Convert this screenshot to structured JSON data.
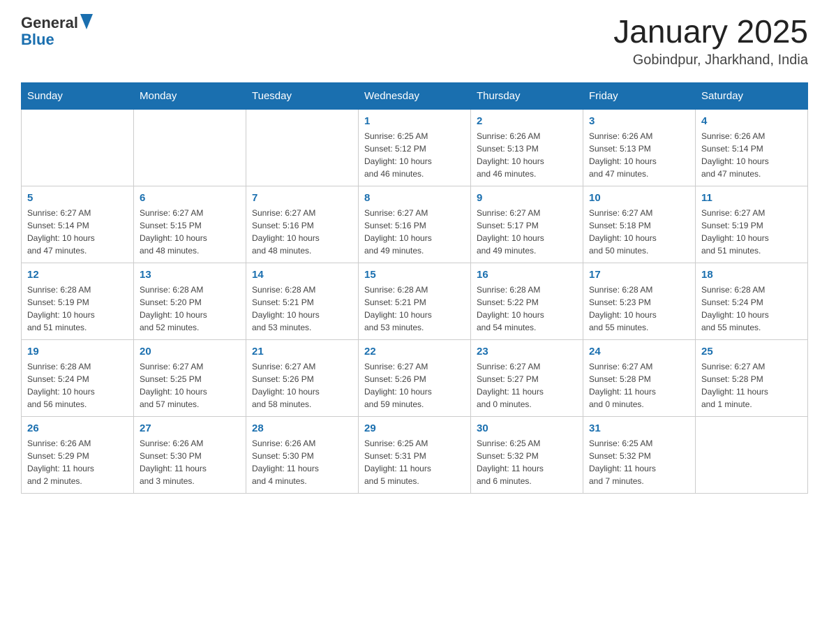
{
  "header": {
    "logo": {
      "text_general": "General",
      "text_blue": "Blue",
      "alt": "GeneralBlue logo"
    },
    "title": "January 2025",
    "subtitle": "Gobindpur, Jharkhand, India"
  },
  "weekdays": [
    "Sunday",
    "Monday",
    "Tuesday",
    "Wednesday",
    "Thursday",
    "Friday",
    "Saturday"
  ],
  "weeks": [
    [
      {
        "day": "",
        "info": ""
      },
      {
        "day": "",
        "info": ""
      },
      {
        "day": "",
        "info": ""
      },
      {
        "day": "1",
        "info": "Sunrise: 6:25 AM\nSunset: 5:12 PM\nDaylight: 10 hours\nand 46 minutes."
      },
      {
        "day": "2",
        "info": "Sunrise: 6:26 AM\nSunset: 5:13 PM\nDaylight: 10 hours\nand 46 minutes."
      },
      {
        "day": "3",
        "info": "Sunrise: 6:26 AM\nSunset: 5:13 PM\nDaylight: 10 hours\nand 47 minutes."
      },
      {
        "day": "4",
        "info": "Sunrise: 6:26 AM\nSunset: 5:14 PM\nDaylight: 10 hours\nand 47 minutes."
      }
    ],
    [
      {
        "day": "5",
        "info": "Sunrise: 6:27 AM\nSunset: 5:14 PM\nDaylight: 10 hours\nand 47 minutes."
      },
      {
        "day": "6",
        "info": "Sunrise: 6:27 AM\nSunset: 5:15 PM\nDaylight: 10 hours\nand 48 minutes."
      },
      {
        "day": "7",
        "info": "Sunrise: 6:27 AM\nSunset: 5:16 PM\nDaylight: 10 hours\nand 48 minutes."
      },
      {
        "day": "8",
        "info": "Sunrise: 6:27 AM\nSunset: 5:16 PM\nDaylight: 10 hours\nand 49 minutes."
      },
      {
        "day": "9",
        "info": "Sunrise: 6:27 AM\nSunset: 5:17 PM\nDaylight: 10 hours\nand 49 minutes."
      },
      {
        "day": "10",
        "info": "Sunrise: 6:27 AM\nSunset: 5:18 PM\nDaylight: 10 hours\nand 50 minutes."
      },
      {
        "day": "11",
        "info": "Sunrise: 6:27 AM\nSunset: 5:19 PM\nDaylight: 10 hours\nand 51 minutes."
      }
    ],
    [
      {
        "day": "12",
        "info": "Sunrise: 6:28 AM\nSunset: 5:19 PM\nDaylight: 10 hours\nand 51 minutes."
      },
      {
        "day": "13",
        "info": "Sunrise: 6:28 AM\nSunset: 5:20 PM\nDaylight: 10 hours\nand 52 minutes."
      },
      {
        "day": "14",
        "info": "Sunrise: 6:28 AM\nSunset: 5:21 PM\nDaylight: 10 hours\nand 53 minutes."
      },
      {
        "day": "15",
        "info": "Sunrise: 6:28 AM\nSunset: 5:21 PM\nDaylight: 10 hours\nand 53 minutes."
      },
      {
        "day": "16",
        "info": "Sunrise: 6:28 AM\nSunset: 5:22 PM\nDaylight: 10 hours\nand 54 minutes."
      },
      {
        "day": "17",
        "info": "Sunrise: 6:28 AM\nSunset: 5:23 PM\nDaylight: 10 hours\nand 55 minutes."
      },
      {
        "day": "18",
        "info": "Sunrise: 6:28 AM\nSunset: 5:24 PM\nDaylight: 10 hours\nand 55 minutes."
      }
    ],
    [
      {
        "day": "19",
        "info": "Sunrise: 6:28 AM\nSunset: 5:24 PM\nDaylight: 10 hours\nand 56 minutes."
      },
      {
        "day": "20",
        "info": "Sunrise: 6:27 AM\nSunset: 5:25 PM\nDaylight: 10 hours\nand 57 minutes."
      },
      {
        "day": "21",
        "info": "Sunrise: 6:27 AM\nSunset: 5:26 PM\nDaylight: 10 hours\nand 58 minutes."
      },
      {
        "day": "22",
        "info": "Sunrise: 6:27 AM\nSunset: 5:26 PM\nDaylight: 10 hours\nand 59 minutes."
      },
      {
        "day": "23",
        "info": "Sunrise: 6:27 AM\nSunset: 5:27 PM\nDaylight: 11 hours\nand 0 minutes."
      },
      {
        "day": "24",
        "info": "Sunrise: 6:27 AM\nSunset: 5:28 PM\nDaylight: 11 hours\nand 0 minutes."
      },
      {
        "day": "25",
        "info": "Sunrise: 6:27 AM\nSunset: 5:28 PM\nDaylight: 11 hours\nand 1 minute."
      }
    ],
    [
      {
        "day": "26",
        "info": "Sunrise: 6:26 AM\nSunset: 5:29 PM\nDaylight: 11 hours\nand 2 minutes."
      },
      {
        "day": "27",
        "info": "Sunrise: 6:26 AM\nSunset: 5:30 PM\nDaylight: 11 hours\nand 3 minutes."
      },
      {
        "day": "28",
        "info": "Sunrise: 6:26 AM\nSunset: 5:30 PM\nDaylight: 11 hours\nand 4 minutes."
      },
      {
        "day": "29",
        "info": "Sunrise: 6:25 AM\nSunset: 5:31 PM\nDaylight: 11 hours\nand 5 minutes."
      },
      {
        "day": "30",
        "info": "Sunrise: 6:25 AM\nSunset: 5:32 PM\nDaylight: 11 hours\nand 6 minutes."
      },
      {
        "day": "31",
        "info": "Sunrise: 6:25 AM\nSunset: 5:32 PM\nDaylight: 11 hours\nand 7 minutes."
      },
      {
        "day": "",
        "info": ""
      }
    ]
  ]
}
